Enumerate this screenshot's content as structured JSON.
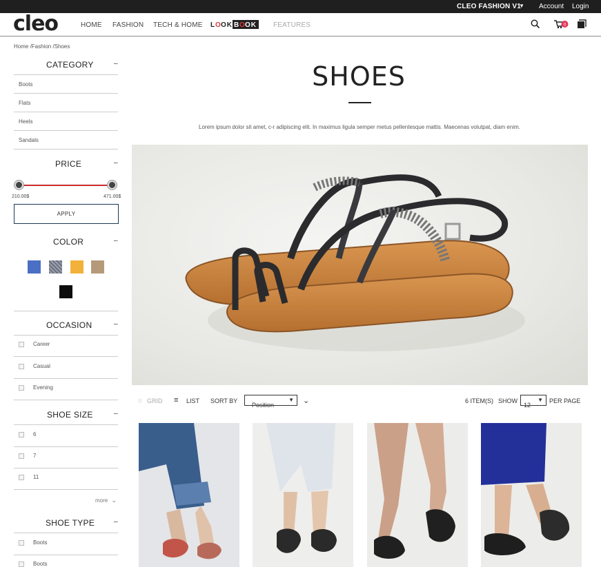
{
  "topbar": {
    "store_switcher": "CLEO FASHION V1",
    "account": "Account",
    "login": "Login"
  },
  "header": {
    "logo": "cleo",
    "nav": [
      "HOME",
      "FASHION",
      "TECH & HOME",
      "FEATURES"
    ],
    "lookbook_logo": "LOOKBOOK",
    "cart_count": "0"
  },
  "breadcrumb": "Home /Fashion /Shoes",
  "sidebar": {
    "category": {
      "title": "CATEGORY",
      "items": [
        "Boots",
        "Flats",
        "Heels",
        "Sandals"
      ]
    },
    "price": {
      "title": "PRICE",
      "min_label": "210.00$",
      "max_label": "471.00$",
      "apply": "APPLY"
    },
    "color": {
      "title": "COLOR",
      "swatches": [
        "#4a6fc4",
        "#7a7f8c",
        "#f2b13a",
        "#b59a7a",
        "#0d0d0d"
      ]
    },
    "occasion": {
      "title": "OCCASION",
      "items": [
        "Career",
        "Casual",
        "Evening"
      ]
    },
    "shoe_size": {
      "title": "SHOE SIZE",
      "items": [
        "6",
        "7",
        "11"
      ],
      "more": "more"
    },
    "shoe_type": {
      "title": "SHOE TYPE",
      "items": [
        "Boots",
        "Boots"
      ]
    },
    "collapse_symbol": "–"
  },
  "main": {
    "title": "SHOES",
    "description": "Lorem ipsum dolor sit amet, c-r adipiscing elit. In maximus ligula semper metus pellentesque mattis. Maecenas volutpat, diam enim.",
    "toolbar": {
      "grid": "GRID",
      "list": "LIST",
      "sort_by": "SORT BY",
      "sort_value": "Position",
      "item_count": "6 ITEM(S)",
      "show": "SHOW",
      "show_value": "12",
      "per_page": "PER PAGE"
    }
  },
  "colors": {
    "accent_red": "#cc2a2a",
    "topbar": "#1f1f1f",
    "cart_badge": "#e0395a"
  }
}
